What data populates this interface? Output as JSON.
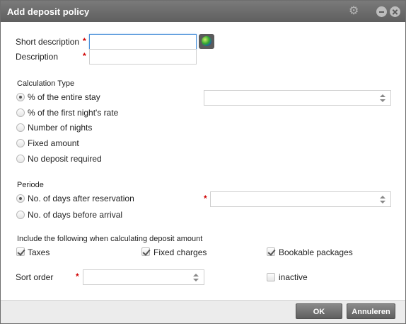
{
  "window": {
    "title": "Add deposit policy",
    "icons": [
      "gear-icon",
      "minimize-icon",
      "close-icon"
    ]
  },
  "form": {
    "short_description": {
      "label": "Short description",
      "required": "*",
      "value": ""
    },
    "description": {
      "label": "Description",
      "required": "*",
      "value": ""
    }
  },
  "calculation_type": {
    "heading": "Calculation Type",
    "options": [
      {
        "label": "% of the entire stay",
        "selected": true
      },
      {
        "label": "% of the first night's rate",
        "selected": false
      },
      {
        "label": "Number of nights",
        "selected": false
      },
      {
        "label": "Fixed amount",
        "selected": false
      },
      {
        "label": "No deposit required",
        "selected": false
      }
    ],
    "value": ""
  },
  "periode": {
    "heading": "Periode",
    "required": "*",
    "options": [
      {
        "label": "No. of days after reservation",
        "selected": true
      },
      {
        "label": "No. of days before arrival",
        "selected": false
      }
    ],
    "value": ""
  },
  "include": {
    "heading": "Include the following when calculating deposit amount",
    "items": [
      {
        "label": "Taxes",
        "checked": true
      },
      {
        "label": "Fixed charges",
        "checked": true
      },
      {
        "label": "Bookable packages",
        "checked": true
      }
    ]
  },
  "sort_order": {
    "label": "Sort order",
    "required": "*",
    "value": ""
  },
  "inactive": {
    "label": "inactive",
    "checked": false
  },
  "buttons": {
    "ok": "OK",
    "cancel": "Annuleren"
  },
  "colors": {
    "title_bar": "#666666",
    "required": "#d00000",
    "focus": "#4a90d9"
  }
}
